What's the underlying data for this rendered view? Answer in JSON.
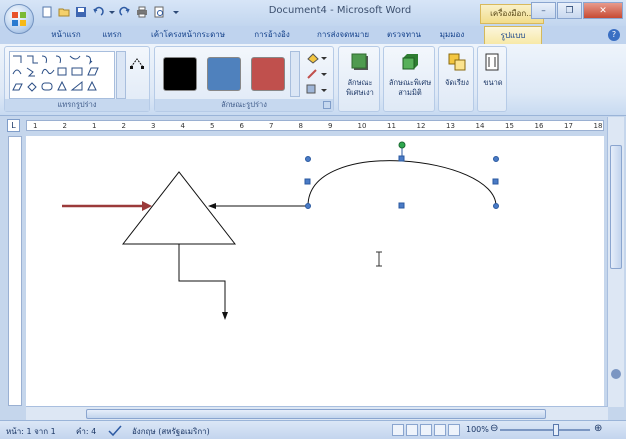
{
  "window": {
    "title": "Document4 - Microsoft Word",
    "context_tab_title": "เครื่องมือก...",
    "controls": {
      "minimize": "–",
      "maximize": "❐",
      "close": "✕"
    },
    "help": "?"
  },
  "tabs": [
    {
      "label": "หน้าแรก",
      "active": false
    },
    {
      "label": "แทรก",
      "active": false
    },
    {
      "label": "เค้าโครงหน้ากระดาษ",
      "active": false
    },
    {
      "label": "การอ้างอิง",
      "active": false
    },
    {
      "label": "การส่งจดหมาย",
      "active": false
    },
    {
      "label": "ตรวจทาน",
      "active": false
    },
    {
      "label": "มุมมอง",
      "active": false
    },
    {
      "label": "รูปแบบ",
      "active": true
    }
  ],
  "ribbon": {
    "groups": {
      "insert_shapes": "แทรกรูปร่าง",
      "shape_styles": "ลักษณะรูปร่าง"
    },
    "swatches": [
      "#000000",
      "#4f81bd",
      "#c0504d"
    ],
    "buttons": {
      "shadow_effects_line1": "ลักษณะ",
      "shadow_effects_line2": "พิเศษเงา",
      "3d_effects_line1": "ลักษณะพิเศษ",
      "3d_effects_line2": "สามมิติ",
      "arrange": "จัดเรียง",
      "size": "ขนาด"
    }
  },
  "ruler": {
    "corner": "L",
    "numbers": [
      "1",
      "2",
      "1",
      "2",
      "3",
      "4",
      "5",
      "6",
      "7",
      "8",
      "9",
      "10",
      "11",
      "12",
      "13",
      "14",
      "15",
      "16",
      "17",
      "18"
    ]
  },
  "status": {
    "page": "หน้า: 1 จาก 1",
    "words": "คำ: 4",
    "language": "อังกฤษ (สหรัฐอเมริกา)",
    "zoom": "100%"
  },
  "colors": {
    "red_arrow": "#9b3a3a",
    "handle_blue": "#4a7bc6",
    "rotate_handle_green": "#2fa84f"
  }
}
